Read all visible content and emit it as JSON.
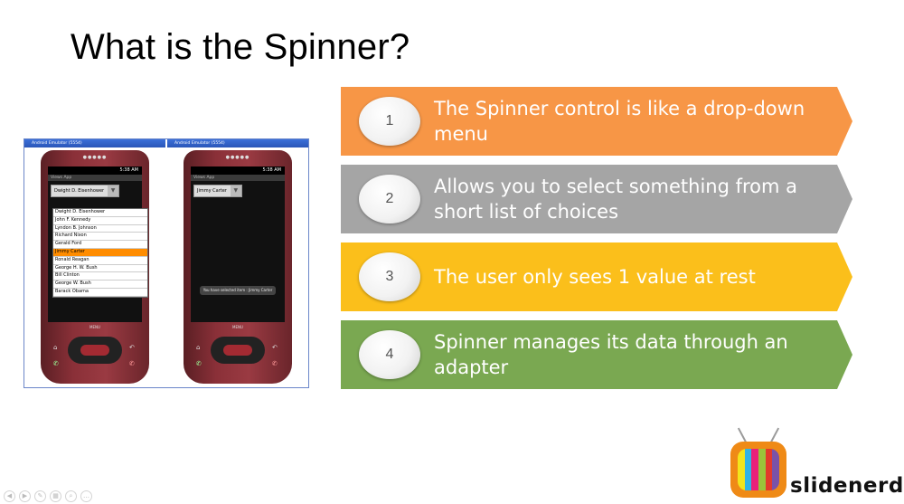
{
  "slide": {
    "title": "What is the Spinner?"
  },
  "screenshots": [
    {
      "window_title": "Android Emulator (5554)",
      "status_time": "5:38 AM",
      "app_title": "Views App",
      "spinner_value": "Dwight D. Eisenhower",
      "dropdown_items": [
        "Dwight D. Eisenhower",
        "John F. Kennedy",
        "Lyndon B. Johnson",
        "Richard Nixon",
        "Gerald Ford",
        "Jimmy Carter",
        "Ronald Reagan",
        "George H. W. Bush",
        "Bill Clinton",
        "George W. Bush",
        "Barack Obama"
      ],
      "selected_item": "Jimmy Carter",
      "menu_label": "MENU"
    },
    {
      "window_title": "Android Emulator (5554)",
      "status_time": "5:38 AM",
      "app_title": "Views App",
      "spinner_value": "Jimmy Carter",
      "toast": "You have selected item : Jimmy Carter",
      "menu_label": "MENU"
    }
  ],
  "steps": [
    {
      "number": "1",
      "text": "The Spinner control is like a drop-down menu",
      "color": "#f79646"
    },
    {
      "number": "2",
      "text": "Allows you to select something from a short list of choices",
      "color": "#a5a5a5"
    },
    {
      "number": "3",
      "text": "The user only sees 1 value at rest",
      "color": "#fbbf1b"
    },
    {
      "number": "4",
      "text": "Spinner manages its data through an adapter",
      "color": "#7aa851"
    }
  ],
  "logo": {
    "brand": "slidenerd",
    "tv_colors": [
      "#f2e51c",
      "#2fb3e6",
      "#e8217a",
      "#9ac43a",
      "#e33a2b",
      "#7a52a8"
    ]
  }
}
